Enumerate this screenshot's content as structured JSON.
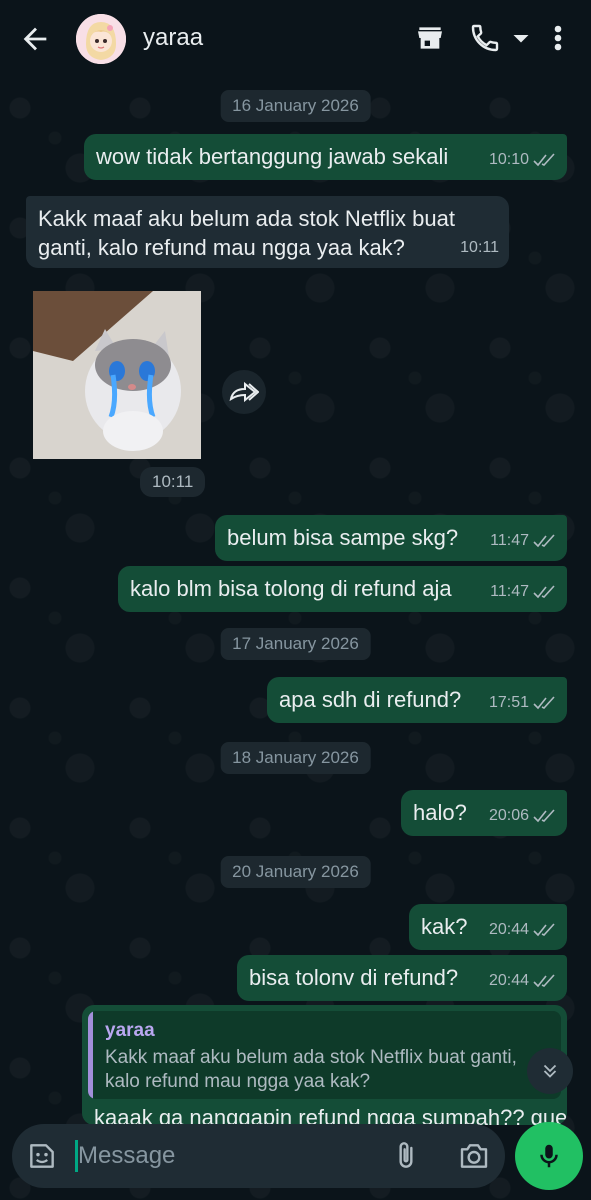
{
  "header": {
    "contact_name": "yaraa",
    "icons": [
      "back-arrow-icon",
      "avatar",
      "shop-icon",
      "phone-icon",
      "dropdown-icon",
      "more-vert-icon"
    ]
  },
  "chat": {
    "dates": [
      "16 January 2026",
      "17 January 2026",
      "18 January 2026",
      "20 January 2026"
    ],
    "messages": [
      {
        "dir": "out",
        "text": "wow tidak bertanggung jawab sekali",
        "time": "10:10"
      },
      {
        "dir": "in",
        "text": "Kakk maaf aku belum ada stok Netflix buat ganti, kalo refund mau ngga yaa kak?",
        "time": "10:11"
      },
      {
        "dir": "in",
        "type": "sticker",
        "time": "10:11"
      },
      {
        "dir": "out",
        "text": "belum bisa sampe skg?",
        "time": "11:47"
      },
      {
        "dir": "out",
        "text": "kalo blm bisa tolong di refund aja",
        "time": "11:47"
      },
      {
        "dir": "out",
        "text": "apa sdh di refund?",
        "time": "17:51"
      },
      {
        "dir": "out",
        "text": "halo?",
        "time": "20:06"
      },
      {
        "dir": "out",
        "text": "kak?",
        "time": "20:44"
      },
      {
        "dir": "out",
        "text": "bisa tolonv di refund?",
        "time": "20:44"
      }
    ],
    "reply": {
      "quoted_name": "yaraa",
      "quoted_text": "Kakk maaf aku belum ada stok Netflix buat ganti, kalo refund mau ngga yaa kak?",
      "partial_text": "kaaak ga nanggapin refund ngga sumpah?? gue bili"
    }
  },
  "composer": {
    "placeholder": "Message"
  },
  "colors": {
    "background": "#0b141a",
    "outgoing_bubble": "#144d37",
    "incoming_bubble": "#1f2c34",
    "accent": "#21c063"
  }
}
